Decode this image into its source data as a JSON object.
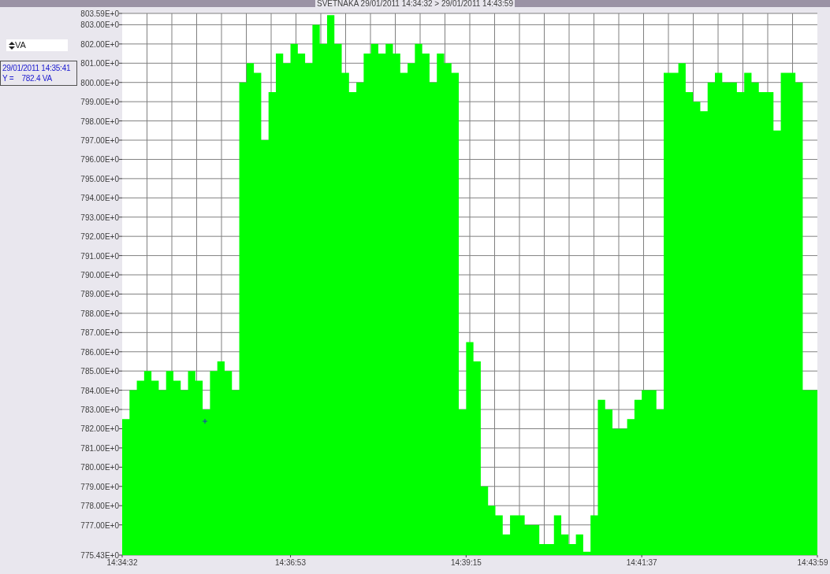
{
  "title": "SVETNAKA  29/01/2011 14:34:32 > 29/01/2011 14:43:59",
  "unit_selector": {
    "value": "VA"
  },
  "cursor_readout": {
    "time": "29/01/2011 14:35:41",
    "value": "Y =    782.4 VA"
  },
  "chart_data": {
    "type": "area",
    "categories": [
      "14:34:32",
      null,
      null,
      null,
      null,
      null,
      null,
      null,
      null,
      null,
      null,
      null,
      null,
      null,
      null,
      null,
      null,
      null,
      null,
      null,
      null,
      null,
      null,
      "14:36:53",
      null,
      null,
      null,
      null,
      null,
      null,
      null,
      null,
      null,
      null,
      null,
      null,
      null,
      null,
      null,
      null,
      null,
      null,
      null,
      null,
      null,
      null,
      null,
      "14:39:15",
      null,
      null,
      null,
      null,
      null,
      null,
      null,
      null,
      null,
      null,
      null,
      null,
      null,
      null,
      null,
      null,
      null,
      null,
      null,
      null,
      null,
      null,
      null,
      "14:41:37",
      null,
      null,
      null,
      null,
      null,
      null,
      null,
      null,
      null,
      null,
      null,
      null,
      null,
      null,
      null,
      null,
      null,
      null,
      null,
      null,
      null,
      null,
      null,
      "14:43:59"
    ],
    "series": [
      {
        "color": "#00ff00",
        "values": [
          782.5,
          784,
          784.5,
          785,
          784.5,
          784,
          785,
          784.5,
          784,
          785,
          784.5,
          783,
          785,
          785.5,
          785,
          784,
          800,
          801,
          800.5,
          797,
          799.5,
          801.5,
          801,
          802,
          801.5,
          801,
          803,
          802,
          803.5,
          802,
          800.5,
          799.5,
          800,
          801.5,
          802,
          801.5,
          802,
          801.5,
          800.5,
          801,
          802,
          801.5,
          800,
          801.5,
          801,
          800.5,
          783,
          786.5,
          785.5,
          779,
          778,
          777.5,
          776.5,
          777.5,
          777.5,
          777,
          777,
          776,
          776,
          777.5,
          776.5,
          776,
          776.5,
          775.6,
          777.5,
          783.5,
          783,
          782,
          782,
          782.5,
          783.5,
          784,
          784,
          783,
          800.5,
          800.5,
          801,
          799.5,
          799,
          798.5,
          800,
          800.5,
          800,
          800,
          799.5,
          800.5,
          800,
          799.5,
          799.5,
          797.5,
          800.5,
          800.5,
          800,
          784,
          784,
          784
        ]
      }
    ],
    "ylim": [
      775.43,
      803.59
    ],
    "grid": true,
    "yticks": [
      {
        "value": 775.43,
        "label": "775.43E+0"
      },
      {
        "value": 777,
        "label": "777.00E+0"
      },
      {
        "value": 778,
        "label": "778.00E+0"
      },
      {
        "value": 779,
        "label": "779.00E+0"
      },
      {
        "value": 780,
        "label": "780.00E+0"
      },
      {
        "value": 781,
        "label": "781.00E+0"
      },
      {
        "value": 782,
        "label": "782.00E+0"
      },
      {
        "value": 783,
        "label": "783.00E+0"
      },
      {
        "value": 784,
        "label": "784.00E+0"
      },
      {
        "value": 785,
        "label": "785.00E+0"
      },
      {
        "value": 786,
        "label": "786.00E+0"
      },
      {
        "value": 787,
        "label": "787.00E+0"
      },
      {
        "value": 788,
        "label": "788.00E+0"
      },
      {
        "value": 789,
        "label": "789.00E+0"
      },
      {
        "value": 790,
        "label": "790.00E+0"
      },
      {
        "value": 791,
        "label": "791.00E+0"
      },
      {
        "value": 792,
        "label": "792.00E+0"
      },
      {
        "value": 793,
        "label": "793.00E+0"
      },
      {
        "value": 794,
        "label": "794.00E+0"
      },
      {
        "value": 795,
        "label": "795.00E+0"
      },
      {
        "value": 796,
        "label": "796.00E+0"
      },
      {
        "value": 797,
        "label": "797.00E+0"
      },
      {
        "value": 798,
        "label": "798.00E+0"
      },
      {
        "value": 799,
        "label": "799.00E+0"
      },
      {
        "value": 800,
        "label": "800.00E+0"
      },
      {
        "value": 801,
        "label": "801.00E+0"
      },
      {
        "value": 802,
        "label": "802.00E+0"
      },
      {
        "value": 803,
        "label": "803.00E+0"
      },
      {
        "value": 803.59,
        "label": "803.59E+0"
      }
    ]
  }
}
